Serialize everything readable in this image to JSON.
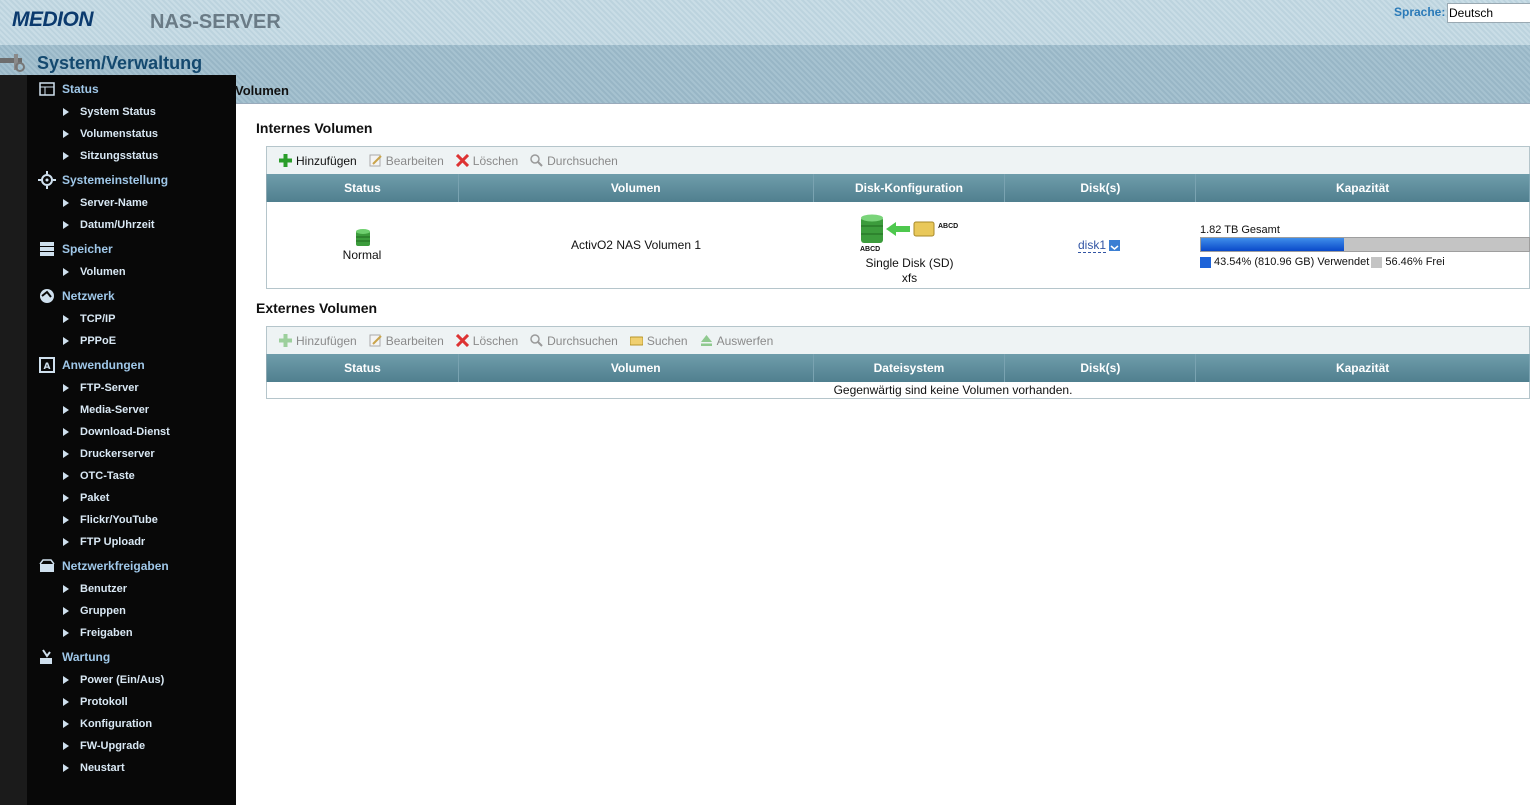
{
  "header": {
    "brand": "MEDION",
    "product": "NAS-SERVER",
    "language_label": "Sprache:",
    "language_value": "Deutsch"
  },
  "section_title": "System/Verwaltung",
  "sidebar": {
    "groups": [
      {
        "label": "Status",
        "icon": "status-icon",
        "items": [
          "System Status",
          "Volumenstatus",
          "Sitzungsstatus"
        ]
      },
      {
        "label": "Systemeinstellung",
        "icon": "gear-icon",
        "items": [
          "Server-Name",
          "Datum/Uhrzeit"
        ]
      },
      {
        "label": "Speicher",
        "icon": "storage-icon",
        "items": [
          "Volumen"
        ]
      },
      {
        "label": "Netzwerk",
        "icon": "network-icon",
        "items": [
          "TCP/IP",
          "PPPoE"
        ]
      },
      {
        "label": "Anwendungen",
        "icon": "applications-icon",
        "items": [
          "FTP-Server",
          "Media-Server",
          "Download-Dienst",
          "Druckerserver",
          "OTC-Taste",
          "Paket",
          "Flickr/YouTube",
          "FTP Uploadr"
        ]
      },
      {
        "label": "Netzwerkfreigaben",
        "icon": "shares-icon",
        "items": [
          "Benutzer",
          "Gruppen",
          "Freigaben"
        ]
      },
      {
        "label": "Wartung",
        "icon": "maintenance-icon",
        "items": [
          "Power (Ein/Aus)",
          "Protokoll",
          "Konfiguration",
          "FW-Upgrade",
          "Neustart"
        ]
      }
    ]
  },
  "main": {
    "title": "Volumen",
    "internal": {
      "title": "Internes Volumen",
      "toolbar": {
        "add": "Hinzufügen",
        "edit": "Bearbeiten",
        "delete": "Löschen",
        "browse": "Durchsuchen"
      },
      "columns": [
        "Status",
        "Volumen",
        "Disk-Konfiguration",
        "Disk(s)",
        "Kapazität"
      ],
      "row": {
        "status": "Normal",
        "volume": "ActivO2 NAS Volumen 1",
        "disk_config_line1": "Single Disk (SD)",
        "disk_config_line2": "xfs",
        "disk_tag": "ABCD",
        "disk_tag2": "ABCD",
        "disks": "disk1",
        "capacity_total": "1.82 TB Gesamt",
        "used_fraction": 0.4354,
        "used_label": "43.54% (810.96 GB) Verwendet",
        "free_label": "56.46% Frei"
      }
    },
    "external": {
      "title": "Externes Volumen",
      "toolbar": {
        "add": "Hinzufügen",
        "edit": "Bearbeiten",
        "delete": "Löschen",
        "browse": "Durchsuchen",
        "search": "Suchen",
        "eject": "Auswerfen"
      },
      "columns": [
        "Status",
        "Volumen",
        "Dateisystem",
        "Disk(s)",
        "Kapazität"
      ],
      "empty_message": "Gegenwärtig sind keine Volumen vorhanden."
    }
  },
  "colors": {
    "sidebar_bg": "#080808",
    "menu_head": "#9fc7e8",
    "table_header": "#5f8e9d",
    "used_bar": "#1d63d8",
    "free_bar": "#c4c4c4"
  }
}
